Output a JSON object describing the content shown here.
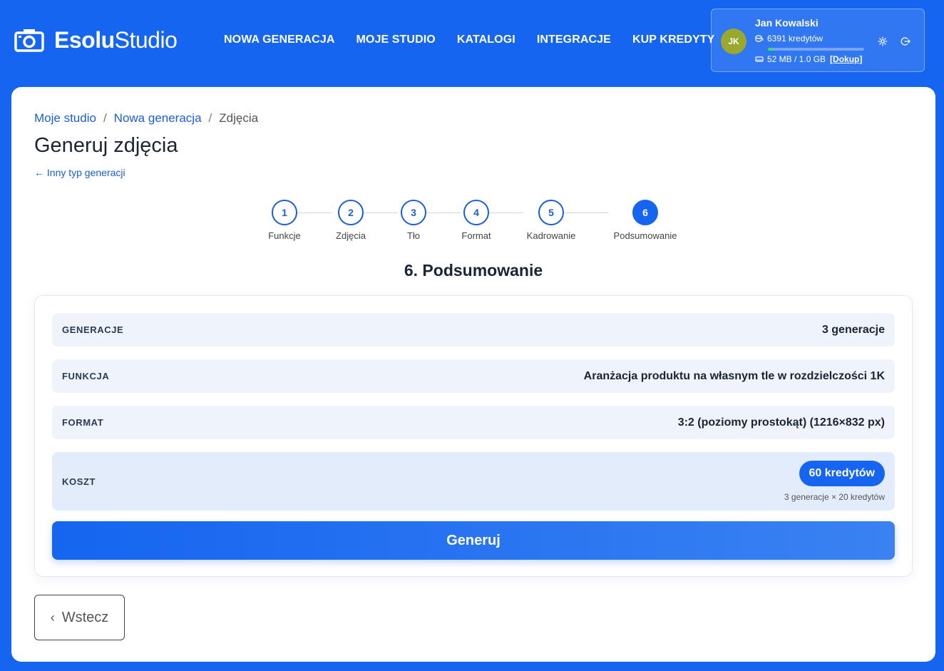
{
  "brand": {
    "bold": "Esolu",
    "regular": "Studio"
  },
  "nav": [
    "NOWA GENERACJA",
    "MOJE STUDIO",
    "KATALOGI",
    "INTEGRACJE",
    "KUP KREDYTY"
  ],
  "user": {
    "initials": "JK",
    "name": "Jan Kowalski",
    "credits": "6391 kredytów",
    "storage": "52 MB / 1.0 GB",
    "storage_used_fraction": 0.05,
    "top_up": "[Dokup]",
    "avatar_color": "#9aa82e"
  },
  "breadcrumb": {
    "item1": "Moje studio",
    "sep": "/",
    "item2": "Nowa generacja",
    "current": "Zdjęcia"
  },
  "page": {
    "title": "Generuj zdjęcia",
    "back_link": "← Inny typ generacji"
  },
  "steps": [
    {
      "num": "1",
      "label": "Funkcje"
    },
    {
      "num": "2",
      "label": "Zdjęcia"
    },
    {
      "num": "3",
      "label": "Tło"
    },
    {
      "num": "4",
      "label": "Format"
    },
    {
      "num": "5",
      "label": "Kadrowanie"
    },
    {
      "num": "6",
      "label": "Podsumowanie"
    }
  ],
  "active_step": 6,
  "section_title": "6. Podsumowanie",
  "summary": {
    "generations": {
      "label": "GENERACJE",
      "value": "3 generacje"
    },
    "function": {
      "label": "FUNKCJA",
      "value": "Aranżacja produktu na własnym tle w rozdzielczości 1K"
    },
    "format": {
      "label": "FORMAT",
      "value": "3:2 (poziomy prostokąt) (1216×832 px)"
    },
    "cost": {
      "label": "KOSZT",
      "value": "60 kredytów",
      "note": "3 generacje × 20 kredytów"
    }
  },
  "buttons": {
    "generate": "Generuj",
    "back": "Wstecz"
  },
  "colors": {
    "primary": "#1565f0",
    "link": "#1a5fd8",
    "row_bg": "#eef3fc"
  }
}
